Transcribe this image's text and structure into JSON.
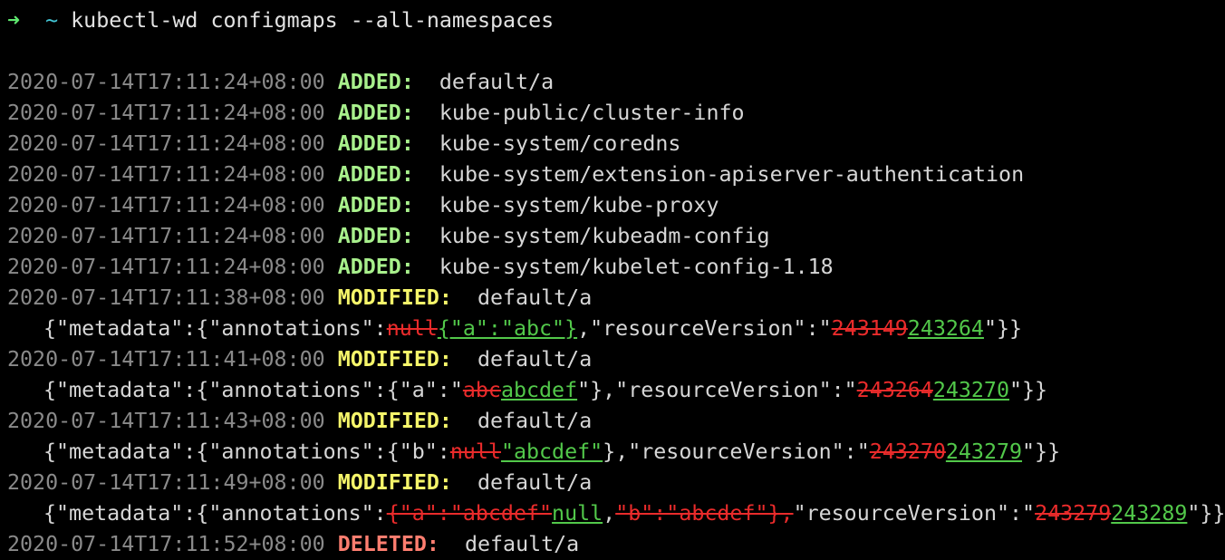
{
  "prompt": {
    "arrow": "➜",
    "cwd": "~",
    "command": "kubectl-wd configmaps --all-namespaces"
  },
  "events": [
    {
      "ts": "2020-07-14T17:11:24+08:00",
      "type": "ADDED:",
      "object": "default/a"
    },
    {
      "ts": "2020-07-14T17:11:24+08:00",
      "type": "ADDED:",
      "object": "kube-public/cluster-info"
    },
    {
      "ts": "2020-07-14T17:11:24+08:00",
      "type": "ADDED:",
      "object": "kube-system/coredns"
    },
    {
      "ts": "2020-07-14T17:11:24+08:00",
      "type": "ADDED:",
      "object": "kube-system/extension-apiserver-authentication"
    },
    {
      "ts": "2020-07-14T17:11:24+08:00",
      "type": "ADDED:",
      "object": "kube-system/kube-proxy"
    },
    {
      "ts": "2020-07-14T17:11:24+08:00",
      "type": "ADDED:",
      "object": "kube-system/kubeadm-config"
    },
    {
      "ts": "2020-07-14T17:11:24+08:00",
      "type": "ADDED:",
      "object": "kube-system/kubelet-config-1.18"
    },
    {
      "ts": "2020-07-14T17:11:38+08:00",
      "type": "MODIFIED:",
      "object": "default/a",
      "diff": {
        "p1": "{\"metadata\":{\"annotations\":",
        "d1": "null",
        "i1": "{\"a\":\"abc\"}",
        "p2": ",\"resourceVersion\":\"",
        "d2": "243149",
        "i2": "243264",
        "p3": "\"}}"
      }
    },
    {
      "ts": "2020-07-14T17:11:41+08:00",
      "type": "MODIFIED:",
      "object": "default/a",
      "diff": {
        "p1": "{\"metadata\":{\"annotations\":{\"a\":\"",
        "d1": "abc",
        "i1": "abcdef",
        "p2": "\"},\"resourceVersion\":\"",
        "d2": "243264",
        "i2": "243270",
        "p3": "\"}}"
      }
    },
    {
      "ts": "2020-07-14T17:11:43+08:00",
      "type": "MODIFIED:",
      "object": "default/a",
      "diff": {
        "p1": "{\"metadata\":{\"annotations\":{\"b\":",
        "d1": "null",
        "i1": "\"abcdef\"",
        "p2": "},\"resourceVersion\":\"",
        "d2": "243270",
        "i2": "243279",
        "p3": "\"}}"
      }
    },
    {
      "ts": "2020-07-14T17:11:49+08:00",
      "type": "MODIFIED:",
      "object": "default/a",
      "diff": {
        "p1": "{\"metadata\":{\"annotations\":",
        "d1": "{\"a\":\"abcdef\"",
        "i1": "null",
        "p2": ",",
        "d1b": "\"b\":\"abcdef\"},",
        "p2b": "\"resourceVersion\":\"",
        "d2": "243279",
        "i2": "243289",
        "p3": "\"}}"
      }
    },
    {
      "ts": "2020-07-14T17:11:52+08:00",
      "type": "DELETED:",
      "object": "default/a"
    }
  ],
  "colors": {
    "background": "#000000",
    "added": "#a8f08c",
    "modified": "#f5f56a",
    "deleted": "#ff7e70",
    "timestamp": "#8a8a8a",
    "diff_removed": "#ea2b2b",
    "diff_inserted": "#52c84a"
  }
}
